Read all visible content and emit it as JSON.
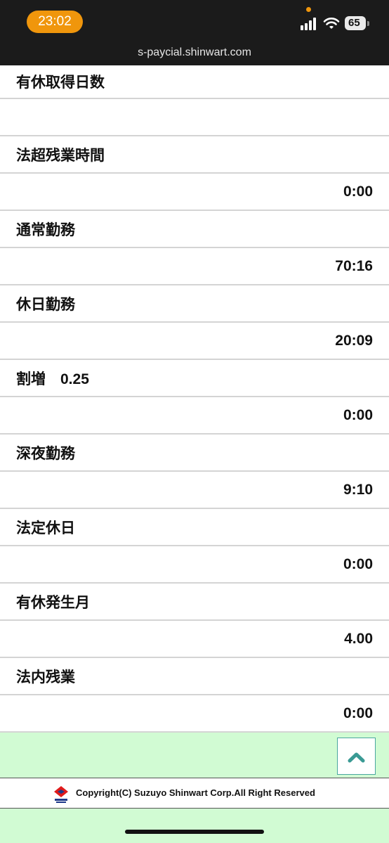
{
  "status_bar": {
    "time": "23:02",
    "battery": "65"
  },
  "browser": {
    "url": "s-paycial.shinwart.com"
  },
  "items": [
    {
      "label": "有休取得日数",
      "value": ""
    },
    {
      "label": "法超残業時間",
      "value": "0:00"
    },
    {
      "label": "通常勤務",
      "value": "70:16"
    },
    {
      "label": "休日勤務",
      "value": "20:09"
    },
    {
      "label": "割増　0.25",
      "value": "0:00"
    },
    {
      "label": "深夜勤務",
      "value": "9:10"
    },
    {
      "label": "法定休日",
      "value": "0:00"
    },
    {
      "label": "有休発生月",
      "value": "4.00"
    },
    {
      "label": "法内残業",
      "value": "0:00"
    }
  ],
  "footer": {
    "copyright": "Copyright(C) Suzuyo Shinwart Corp.All Right Reserved"
  },
  "colors": {
    "accent": "#f0960c",
    "page_bg": "#d1fbd3",
    "button_border": "#4aa6a0",
    "chevron": "#3a9a94"
  },
  "icons": [
    "signal-icon",
    "wifi-icon",
    "battery-icon",
    "chevron-up-icon",
    "company-logo-icon"
  ]
}
